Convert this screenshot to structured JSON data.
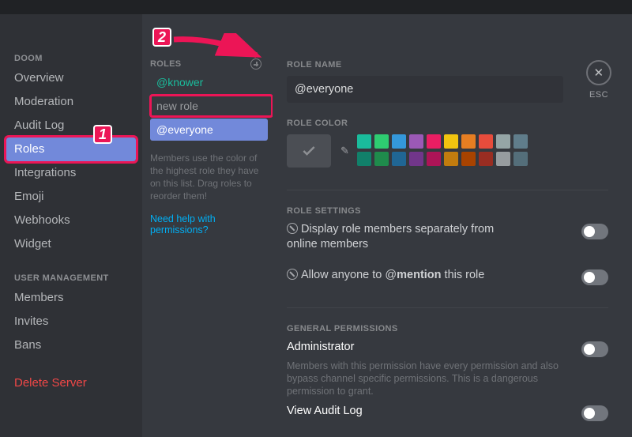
{
  "sidebar": {
    "server": "DOOM",
    "items": [
      "Overview",
      "Moderation",
      "Audit Log",
      "Roles",
      "Integrations",
      "Emoji",
      "Webhooks",
      "Widget"
    ],
    "mgmt_head": "USER MANAGEMENT",
    "mgmt": [
      "Members",
      "Invites",
      "Bans"
    ],
    "delete": "Delete Server"
  },
  "roles": {
    "head": "ROLES",
    "items": [
      "@knower",
      "new role",
      "@everyone"
    ],
    "help_text": "Members use the color of the highest role they have on this list. Drag roles to reorder them!",
    "link": "Need help with permissions?"
  },
  "panel": {
    "name_label": "ROLE NAME",
    "name_value": "@everyone",
    "color_label": "ROLE COLOR",
    "swatches_row1": [
      "#1abc9c",
      "#2ecc71",
      "#3498db",
      "#9b59b6",
      "#e91e63",
      "#f1c40f",
      "#e67e22",
      "#e74c3c",
      "#95a5a6",
      "#607d8b"
    ],
    "swatches_row2": [
      "#11806a",
      "#1f8b4c",
      "#206694",
      "#71368a",
      "#ad1457",
      "#c27c0e",
      "#a84300",
      "#992d22",
      "#979c9f",
      "#546e7a"
    ],
    "settings_head": "ROLE SETTINGS",
    "display_sep": "Display role members separately from online members",
    "allow_mention_pre": "Allow anyone to @",
    "allow_mention_bold": "mention",
    "allow_mention_post": " this role",
    "gen_head": "GENERAL PERMISSIONS",
    "admin": "Administrator",
    "admin_sub": "Members with this permission have every permission and also bypass channel specific permissions. This is a dangerous permission to grant.",
    "audit": "View Audit Log",
    "esc": "ESC"
  },
  "annotations": {
    "one": "1",
    "two": "2"
  }
}
